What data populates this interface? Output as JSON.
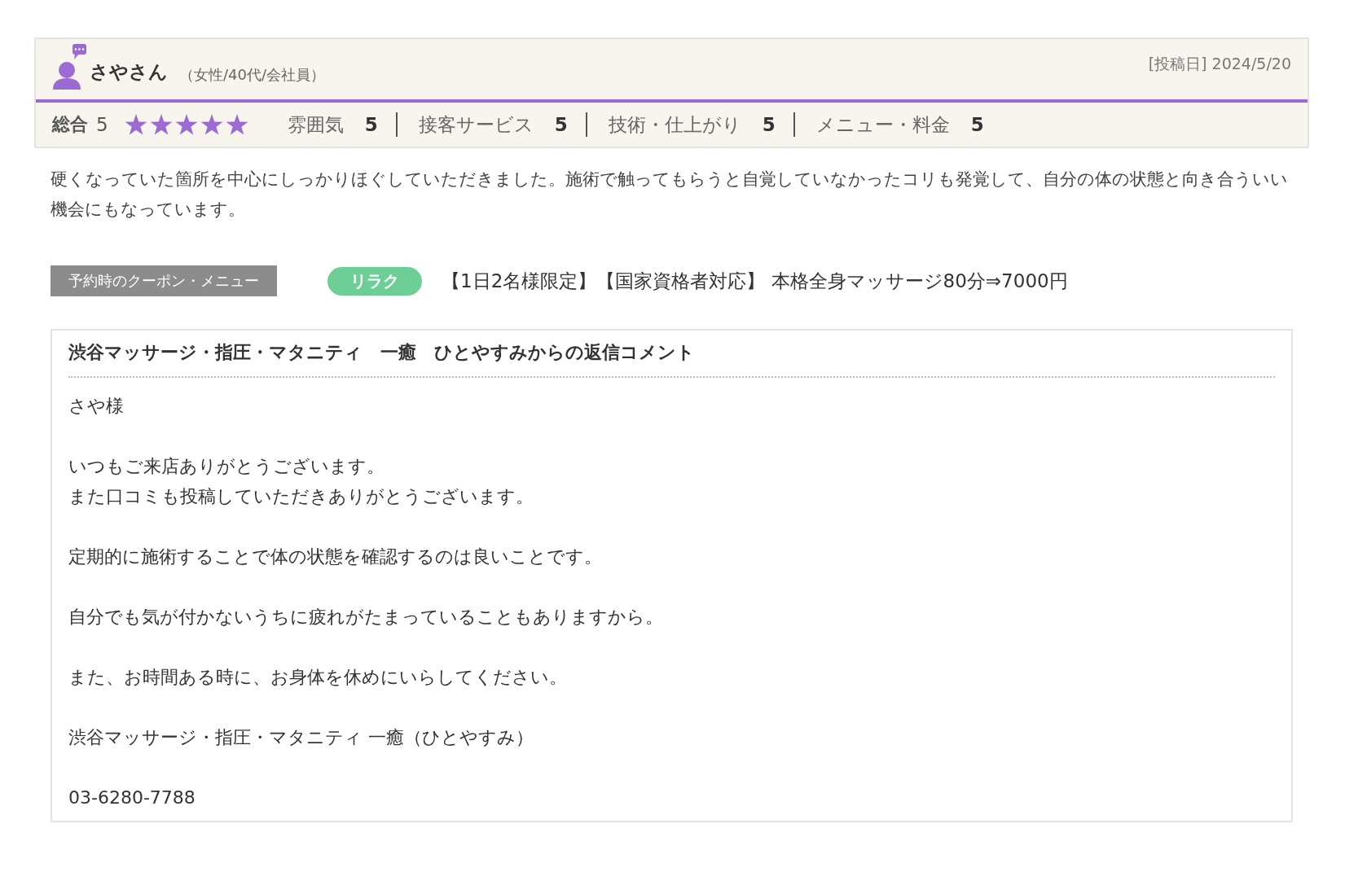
{
  "review": {
    "reviewer": "さやさん",
    "profile": "（女性/40代/会社員）",
    "posted": "[投稿日] 2024/5/20",
    "overall": {
      "label": "総合",
      "score": "5",
      "stars": 5
    },
    "ratings": [
      {
        "label": "雰囲気",
        "score": "5"
      },
      {
        "label": "接客サービス",
        "score": "5"
      },
      {
        "label": "技術・仕上がり",
        "score": "5"
      },
      {
        "label": "メニュー・料金",
        "score": "5"
      }
    ],
    "body": "硬くなっていた箇所を中心にしっかりほぐしていただきました。施術で触ってもらうと自覚していなかったコリも発覚して、自分の体の状態と向き合ういい機会にもなっています。",
    "coupon": {
      "label": "予約時のクーポン・メニュー",
      "tag": "リラク",
      "color": "#6dcf96",
      "name": "【1日2名様限定】【国家資格者対応】 本格全身マッサージ80分⇒7000円"
    },
    "reply": {
      "title": "渋谷マッサージ・指圧・マタニティ　一癒　ひとやすみからの返信コメント",
      "paragraphs": [
        [
          "さや様"
        ],
        [
          "いつもご来店ありがとうございます。",
          "また口コミも投稿していただきありがとうございます。"
        ],
        [
          "定期的に施術することで体の状態を確認するのは良いことです。"
        ],
        [
          "自分でも気が付かないうちに疲れがたまっていることもありますから。"
        ],
        [
          "また、お時間ある時に、お身体を休めにいらしてください。"
        ],
        [
          "渋谷マッサージ・指圧・マタニティ 一癒（ひとやすみ）"
        ],
        [
          "03-6280-7788"
        ]
      ]
    }
  }
}
